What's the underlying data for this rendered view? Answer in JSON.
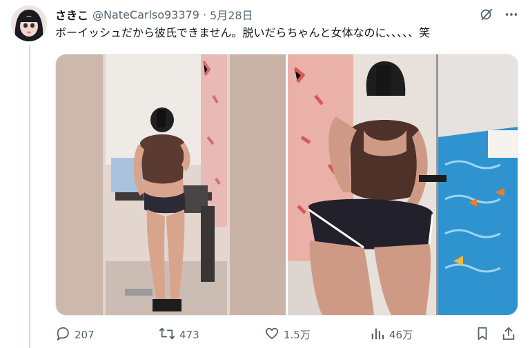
{
  "tweet": {
    "display_name": "さきこ",
    "handle": "@NateCarlso93379",
    "separator": "·",
    "date": "5月28日",
    "text": "ボーイッシュだから彼氏できません。脱いだらちゃんと女体なのに、、、、、笑"
  },
  "icons": {
    "top_right": [
      "grok-icon",
      "more-icon"
    ],
    "actions": [
      "reply-icon",
      "retweet-icon",
      "like-icon",
      "views-icon",
      "bookmark-icon",
      "share-icon"
    ]
  },
  "stats": {
    "replies": "207",
    "retweets": "473",
    "likes": "1.5万",
    "views": "46万"
  },
  "colors": {
    "text_primary": "#0f1419",
    "text_secondary": "#536471",
    "thread_line": "#cfd9de"
  }
}
